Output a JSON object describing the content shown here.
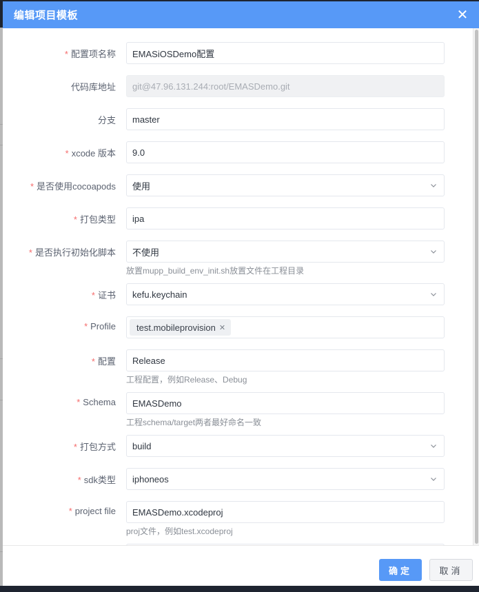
{
  "dialog": {
    "title": "编辑项目模板",
    "close_icon": "close-icon"
  },
  "form": {
    "required_mark": "*",
    "fields": [
      {
        "label": "配置项名称",
        "required": true,
        "type": "input",
        "value": "EMASiOSDemo配置"
      },
      {
        "label": "代码库地址",
        "required": false,
        "type": "input-disabled",
        "value": "git@47.96.131.244:root/EMASDemo.git"
      },
      {
        "label": "分支",
        "required": false,
        "type": "input",
        "value": "master"
      },
      {
        "label": "xcode 版本",
        "required": true,
        "type": "input",
        "value": "9.0"
      },
      {
        "label": "是否使用cocoapods",
        "required": true,
        "type": "select",
        "value": "使用"
      },
      {
        "label": "打包类型",
        "required": true,
        "type": "input",
        "value": "ipa"
      },
      {
        "label": "是否执行初始化脚本",
        "required": true,
        "type": "select",
        "value": "不使用",
        "hint": "放置mupp_build_env_init.sh放置文件在工程目录"
      },
      {
        "label": "证书",
        "required": true,
        "type": "select",
        "value": "kefu.keychain"
      },
      {
        "label": "Profile",
        "required": true,
        "type": "multiselect",
        "tags": [
          "test.mobileprovision"
        ]
      },
      {
        "label": "配置",
        "required": true,
        "type": "input",
        "value": "Release",
        "hint": "工程配置，例如Release、Debug"
      },
      {
        "label": "Schema",
        "required": true,
        "type": "input",
        "value": "EMASDemo",
        "hint": "工程schema/target两者最好命名一致"
      },
      {
        "label": "打包方式",
        "required": true,
        "type": "select",
        "value": "build"
      },
      {
        "label": "sdk类型",
        "required": true,
        "type": "select",
        "value": "iphoneos"
      },
      {
        "label": "project file",
        "required": true,
        "type": "input",
        "value": "EMASDemo.xcodeproj",
        "hint": "proj文件，例如test.xcodeproj"
      }
    ]
  },
  "footer": {
    "confirm_label": "确定",
    "cancel_label": "取消"
  },
  "colors": {
    "accent": "#5799f7",
    "required": "#f56c6c"
  }
}
